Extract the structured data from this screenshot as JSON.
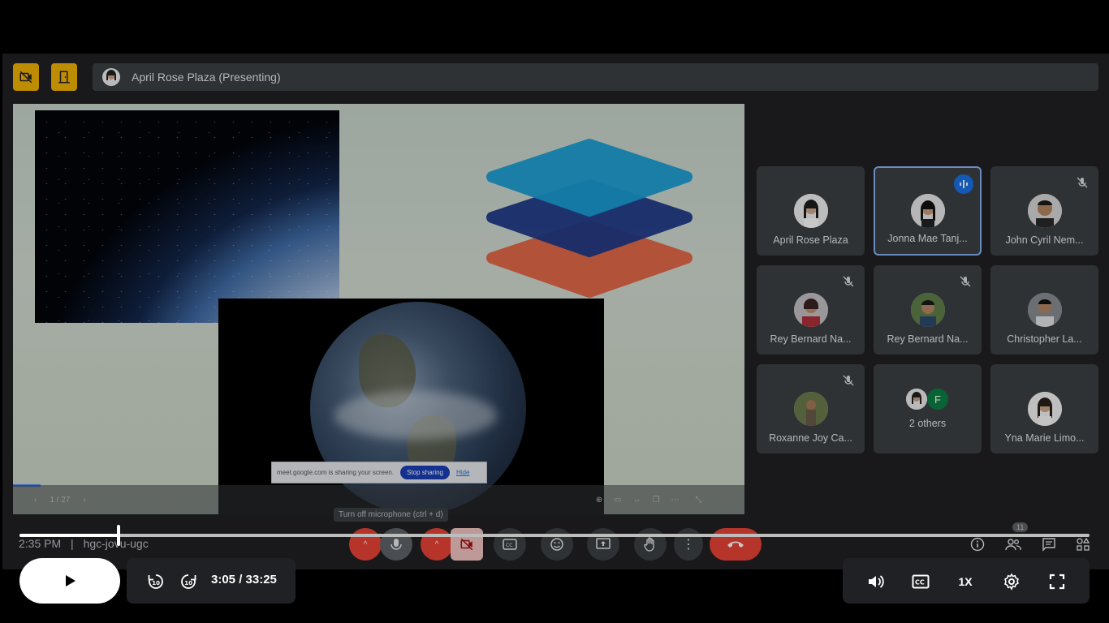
{
  "meeting": {
    "presenter_label": "April Rose Plaza (Presenting)",
    "meeting_time": "2:35 PM",
    "meeting_code": "hgc-jovu-ugc",
    "tooltip": "Turn off microphone (ctrl + d)",
    "people_count": "11"
  },
  "slide": {
    "page": "1 / 27",
    "share_notice": "meet.google.com is sharing your screen.",
    "stop_sharing": "Stop sharing",
    "hide": "Hide"
  },
  "participants": [
    {
      "name": "April Rose Plaza",
      "muted": false,
      "speaking": false
    },
    {
      "name": "Jonna Mae Tanj...",
      "muted": false,
      "speaking": true
    },
    {
      "name": "John Cyril Nem...",
      "muted": true,
      "speaking": false
    },
    {
      "name": "Rey Bernard Na...",
      "muted": true,
      "speaking": false
    },
    {
      "name": "Rey Bernard Na...",
      "muted": true,
      "speaking": false
    },
    {
      "name": "Christopher La...",
      "muted": false,
      "speaking": false
    },
    {
      "name": "Roxanne Joy Ca...",
      "muted": true,
      "speaking": false
    },
    {
      "name": "2 others",
      "muted": false,
      "speaking": false,
      "initial": "F"
    },
    {
      "name": "Yna Marie Limo...",
      "muted": false,
      "speaking": false
    }
  ],
  "player": {
    "time": "3:05 / 33:25",
    "progress": 0.0923,
    "speed": "1X"
  },
  "colors": {
    "accent_yellow": "#f4b400",
    "end_call_red": "#ea4335",
    "speaking_blue": "#1a73e8"
  }
}
